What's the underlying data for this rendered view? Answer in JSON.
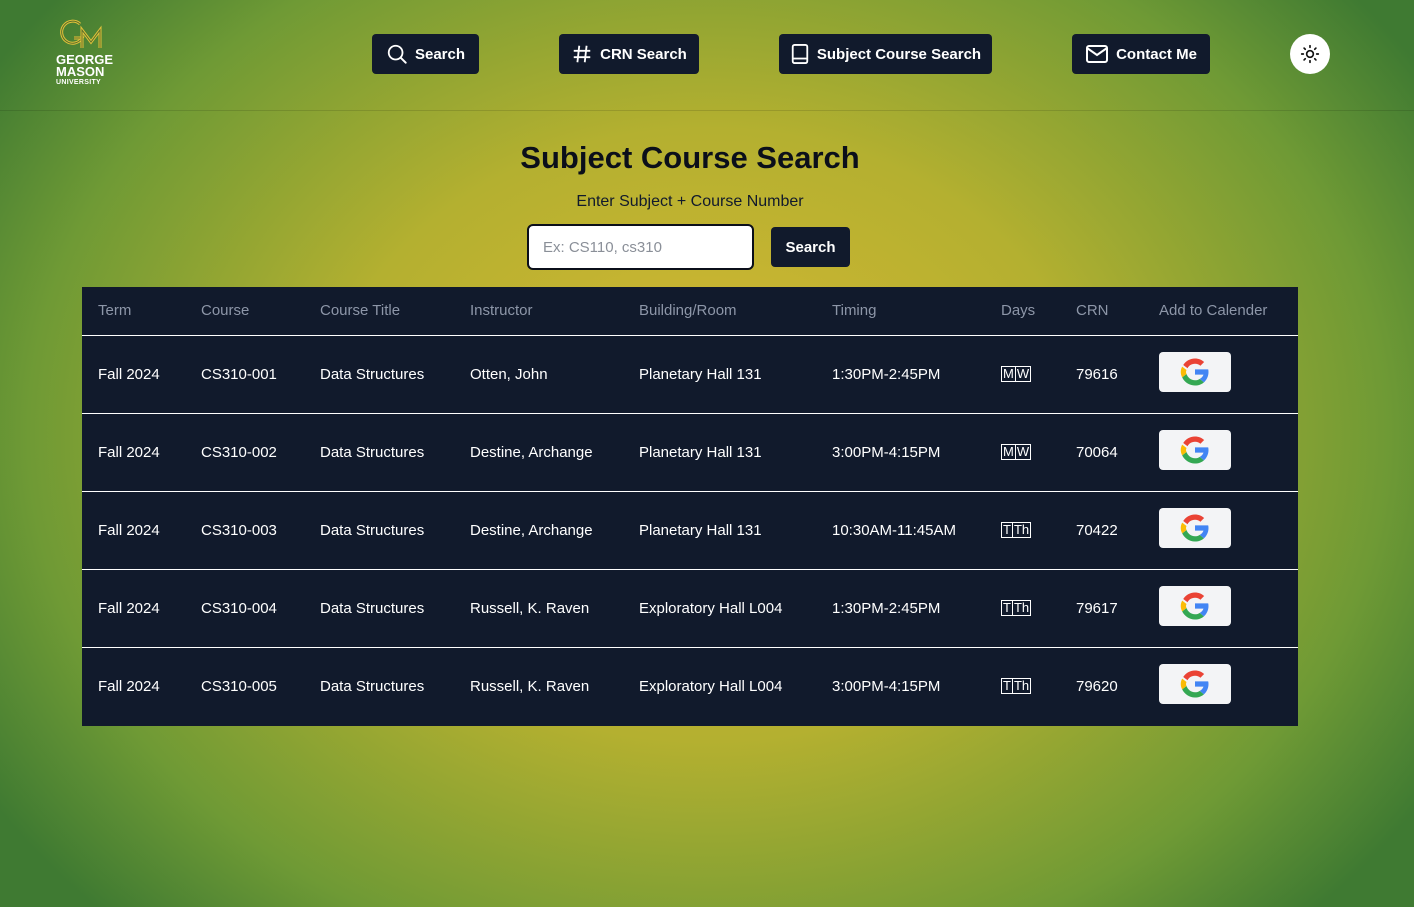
{
  "brand": {
    "line1": "GEORGE",
    "line2": "MASON",
    "line3": "UNIVERSITY"
  },
  "nav": {
    "search": "Search",
    "crn_search": "CRN Search",
    "subject_course_search": "Subject Course Search",
    "contact": "Contact Me"
  },
  "page": {
    "title": "Subject Course Search",
    "subtitle": "Enter Subject + Course Number",
    "search_placeholder": "Ex: CS110, cs310",
    "search_value": "",
    "search_button": "Search"
  },
  "table": {
    "headers": [
      "Term",
      "Course",
      "Course Title",
      "Instructor",
      "Building/Room",
      "Timing",
      "Days",
      "CRN",
      "Add to Calender"
    ],
    "rows": [
      {
        "term": "Fall 2024",
        "course": "CS310-001",
        "title": "Data Structures",
        "instructor": "Otten, John",
        "room": "Planetary Hall 131",
        "timing": "1:30PM-2:45PM",
        "days": [
          "M",
          "W"
        ],
        "crn": "79616"
      },
      {
        "term": "Fall 2024",
        "course": "CS310-002",
        "title": "Data Structures",
        "instructor": "Destine, Archange",
        "room": "Planetary Hall 131",
        "timing": "3:00PM-4:15PM",
        "days": [
          "M",
          "W"
        ],
        "crn": "70064"
      },
      {
        "term": "Fall 2024",
        "course": "CS310-003",
        "title": "Data Structures",
        "instructor": "Destine, Archange",
        "room": "Planetary Hall 131",
        "timing": "10:30AM-11:45AM",
        "days": [
          "T",
          "Th"
        ],
        "crn": "70422"
      },
      {
        "term": "Fall 2024",
        "course": "CS310-004",
        "title": "Data Structures",
        "instructor": "Russell, K. Raven",
        "room": "Exploratory Hall L004",
        "timing": "1:30PM-2:45PM",
        "days": [
          "T",
          "Th"
        ],
        "crn": "79617"
      },
      {
        "term": "Fall 2024",
        "course": "CS310-005",
        "title": "Data Structures",
        "instructor": "Russell, K. Raven",
        "room": "Exploratory Hall L004",
        "timing": "3:00PM-4:15PM",
        "days": [
          "T",
          "Th"
        ],
        "crn": "79620"
      }
    ]
  },
  "icons": {
    "nav_search": "magnifier-icon",
    "nav_crn": "hash-icon",
    "nav_subject": "book-icon",
    "nav_contact": "envelope-icon",
    "theme": "sun-icon",
    "calendar": "google-g-icon"
  },
  "colors": {
    "dark": "#111a2c",
    "header_text": "#8d96a8",
    "brand_gold": "#d8b832",
    "brand_green": "#3f7a32"
  }
}
